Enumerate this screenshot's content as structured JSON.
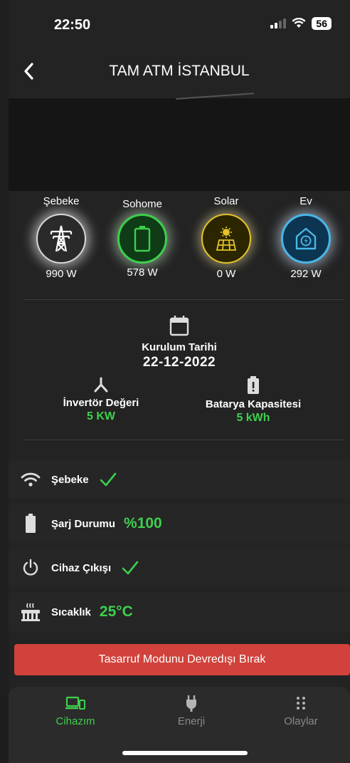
{
  "status_bar": {
    "time": "22:50",
    "battery": "56"
  },
  "header": {
    "title": "TAM ATM İSTANBUL"
  },
  "devices": [
    {
      "label": "Şebeke",
      "value": "990 W",
      "icon": "transmission-tower-icon"
    },
    {
      "label": "Sohome",
      "value": "578 W",
      "icon": "battery-icon"
    },
    {
      "label": "Solar",
      "value": "0 W",
      "icon": "solar-panel-icon"
    },
    {
      "label": "Ev",
      "value": "292 W",
      "icon": "home-energy-icon"
    }
  ],
  "install": {
    "label": "Kurulum Tarihi",
    "date": "22-12-2022"
  },
  "inverter": {
    "label": "İnvertör Değeri",
    "value": "5 KW"
  },
  "battery_capacity": {
    "label": "Batarya Kapasitesi",
    "value": "5 kWh"
  },
  "status_rows": {
    "grid": {
      "label": "Şebeke",
      "icon": "wifi-icon",
      "ok": true
    },
    "charge": {
      "label": "Şarj Durumu",
      "value": "%100",
      "icon": "battery-icon"
    },
    "output": {
      "label": "Cihaz Çıkışı",
      "icon": "power-icon",
      "ok": true
    },
    "temperature": {
      "label": "Sıcaklık",
      "value": "25°C",
      "icon": "heater-icon"
    }
  },
  "save_button": {
    "label": "Tasarruf Modunu Devredışı Bırak"
  },
  "bottom_nav": [
    {
      "label": "Cihazım",
      "icon": "devices-icon",
      "active": true
    },
    {
      "label": "Enerji",
      "icon": "plug-icon",
      "active": false
    },
    {
      "label": "Olaylar",
      "icon": "dots-grid-icon",
      "active": false
    }
  ],
  "colors": {
    "accent": "#3ecf4e",
    "danger": "#d0423b",
    "background": "#232323"
  }
}
